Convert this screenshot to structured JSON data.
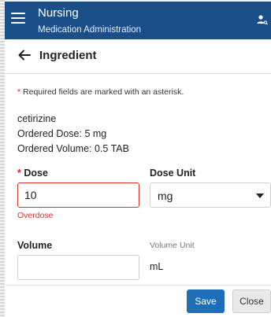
{
  "app": {
    "title": "Nursing",
    "subtitle": "Medication Administration"
  },
  "header": {
    "title": "Ingredient"
  },
  "form": {
    "required_asterisk": "*",
    "required_note": "Required fields are marked with an asterisk.",
    "medication_name": "cetirizine",
    "ordered_dose": "Ordered Dose: 5 mg",
    "ordered_volume": "Ordered Volume: 0.5 TAB",
    "dose": {
      "required_marker": "*",
      "label": "Dose",
      "value": "10",
      "error": "Overdose"
    },
    "dose_unit": {
      "label": "Dose Unit",
      "selected": "mg"
    },
    "volume": {
      "label": "Volume",
      "value": ""
    },
    "volume_unit": {
      "label": "Volume Unit",
      "value": "mL"
    }
  },
  "footer": {
    "save_label": "Save",
    "close_label": "Close"
  },
  "colors": {
    "header_bg": "#1b4f8a",
    "error": "#d9352f",
    "primary_button": "#1f6fb8"
  },
  "icons": {
    "menu": "hamburger-menu-icon",
    "user": "user-search-icon",
    "back": "arrow-left-icon",
    "dropdown": "caret-down-icon"
  }
}
